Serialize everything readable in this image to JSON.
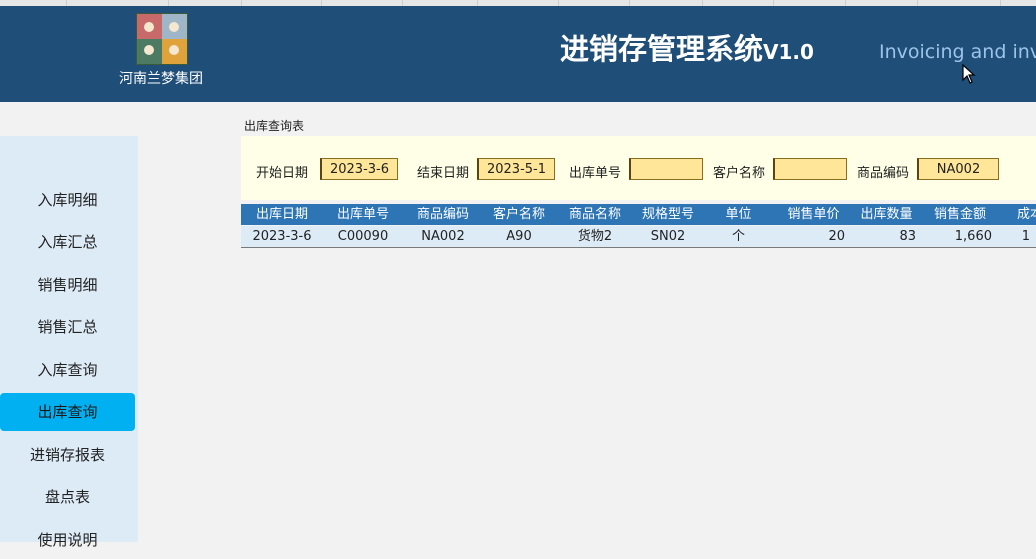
{
  "header": {
    "company": "河南兰梦集团",
    "title": "进销存管理系统",
    "version": "V1.0",
    "subtitle": "Invoicing and invent"
  },
  "sidebar": {
    "items": [
      {
        "label": "入库明细"
      },
      {
        "label": "入库汇总"
      },
      {
        "label": "销售明细"
      },
      {
        "label": "销售汇总"
      },
      {
        "label": "入库查询"
      },
      {
        "label": "出库查询",
        "active": true
      },
      {
        "label": "进销存报表"
      },
      {
        "label": "盘点表"
      },
      {
        "label": "使用说明"
      }
    ]
  },
  "section_label": "出库查询表",
  "filters": {
    "start_date_label": "开始日期",
    "start_date_value": "2023-3-6",
    "end_date_label": "结束日期",
    "end_date_value": "2023-5-1",
    "order_no_label": "出库单号",
    "order_no_value": "",
    "customer_label": "客户名称",
    "customer_value": "",
    "product_code_label": "商品编码",
    "product_code_value": "NA002"
  },
  "table": {
    "headers": [
      "出库日期",
      "出库单号",
      "商品编码",
      "客户名称",
      "商品名称",
      "规格型号",
      "单位",
      "销售单价",
      "出库数量",
      "销售金额",
      "成本"
    ],
    "rows": [
      [
        "2023-3-6",
        "C00090",
        "NA002",
        "A90",
        "货物2",
        "SN02",
        "个",
        "20",
        "83",
        "1,660",
        "1"
      ]
    ]
  },
  "colors": {
    "header_bg": "#1f4e79",
    "sidebar_bg": "#ddebf7",
    "active_nav": "#00b0f0",
    "table_header": "#2e75b6",
    "input_bg": "#ffe699",
    "filter_panel_bg": "#ffffe7"
  }
}
